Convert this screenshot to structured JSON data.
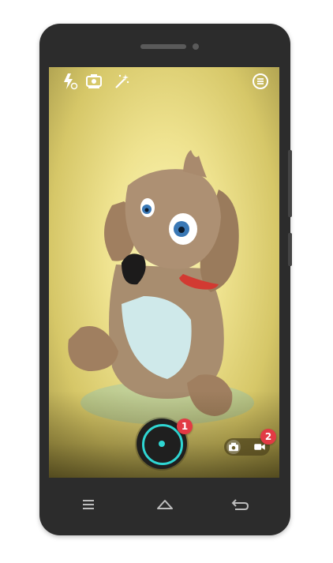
{
  "camera": {
    "badges": {
      "shutter_badge": "1",
      "mode_badge": "2"
    },
    "toolbar_icons": [
      "flash-auto-icon",
      "switch-camera-icon",
      "magic-wand-icon",
      "menu-icon"
    ],
    "mode_toggle": [
      "photo-camera-icon",
      "video-camera-icon"
    ]
  },
  "navbar_icons": [
    "recent-apps-icon",
    "home-icon",
    "back-icon"
  ],
  "colors": {
    "accent": "#2fd6d3",
    "badge": "#e23a44"
  }
}
